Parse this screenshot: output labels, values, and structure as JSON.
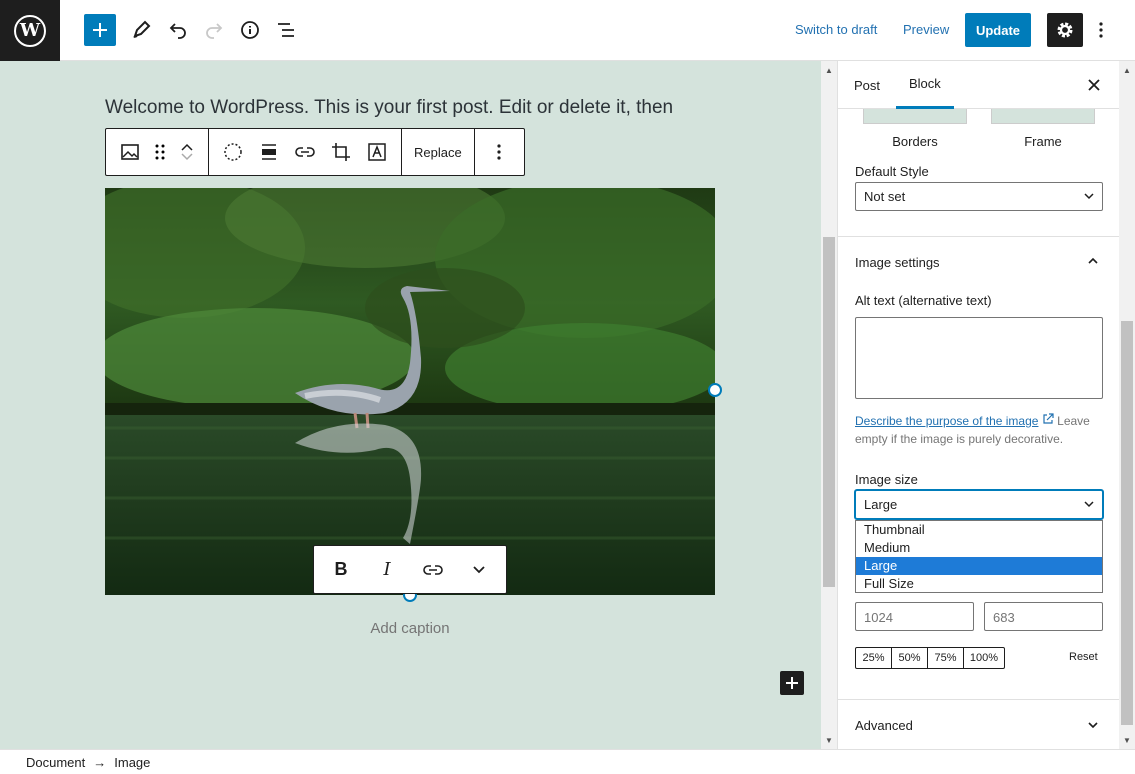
{
  "topbar": {
    "logo": "W",
    "switch_to_draft": "Switch to draft",
    "preview": "Preview",
    "update": "Update"
  },
  "editor": {
    "paragraph": "Welcome to WordPress. This is your first post. Edit or delete it, then",
    "replace_label": "Replace",
    "caption_placeholder": "Add caption",
    "format": {
      "bold": "B",
      "italic": "I"
    }
  },
  "sidebar": {
    "tabs": [
      "Post",
      "Block"
    ],
    "active_tab": "Block",
    "styles": [
      "Borders",
      "Frame"
    ],
    "default_style_label": "Default Style",
    "default_style_value": "Not set",
    "image_settings_title": "Image settings",
    "alt_text_label": "Alt text (alternative text)",
    "help_link": "Describe the purpose of the image",
    "help_text": "Leave empty if the image is purely decorative.",
    "image_size_label": "Image size",
    "image_size_value": "Large",
    "image_size_options": [
      "Thumbnail",
      "Medium",
      "Large",
      "Full Size"
    ],
    "width": "1024",
    "height": "683",
    "percent_options": [
      "25%",
      "50%",
      "75%",
      "100%"
    ],
    "reset": "Reset",
    "advanced_title": "Advanced"
  },
  "breadcrumb": {
    "items": [
      "Document",
      "Image"
    ],
    "separator": "→"
  },
  "colors": {
    "accent": "#007cba",
    "canvas_bg": "#d4e3dc",
    "dark": "#1e1e1e",
    "selected_option": "#1e7bd7"
  }
}
